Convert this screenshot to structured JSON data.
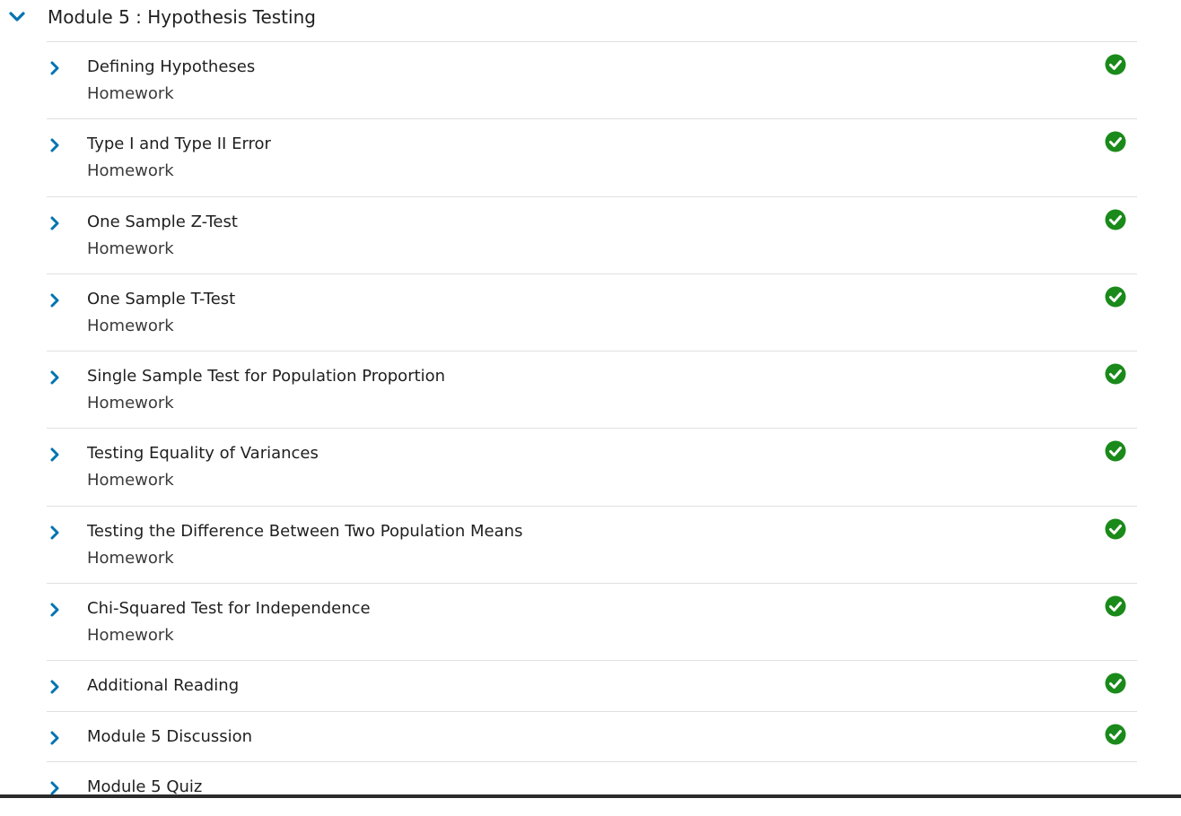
{
  "colors": {
    "accent": "#0073b0",
    "check": "#1a8a1a",
    "divider": "#e0e0e0"
  },
  "module": {
    "title": "Module 5 : Hypothesis Testing",
    "expand_icon": "chevron-down-icon"
  },
  "items": [
    {
      "title": "Defining Hypotheses",
      "subtitle": "Homework",
      "status_icon": "check-circle-icon"
    },
    {
      "title": "Type I and Type II Error",
      "subtitle": "Homework",
      "status_icon": "check-circle-icon"
    },
    {
      "title": "One Sample Z-Test",
      "subtitle": "Homework",
      "status_icon": "check-circle-icon"
    },
    {
      "title": "One Sample T-Test",
      "subtitle": "Homework",
      "status_icon": "check-circle-icon"
    },
    {
      "title": "Single Sample Test for Population Proportion",
      "subtitle": "Homework",
      "status_icon": "check-circle-icon"
    },
    {
      "title": "Testing Equality of Variances",
      "subtitle": "Homework",
      "status_icon": "check-circle-icon"
    },
    {
      "title": "Testing the Difference Between Two Population Means",
      "subtitle": "Homework",
      "status_icon": "check-circle-icon"
    },
    {
      "title": "Chi-Squared Test for Independence",
      "subtitle": "Homework",
      "status_icon": "check-circle-icon"
    },
    {
      "title": "Additional Reading",
      "subtitle": "",
      "status_icon": "check-circle-icon"
    },
    {
      "title": "Module 5 Discussion",
      "subtitle": "",
      "status_icon": "check-circle-icon"
    },
    {
      "title": "Module 5 Quiz",
      "subtitle": "",
      "status_icon": ""
    }
  ]
}
